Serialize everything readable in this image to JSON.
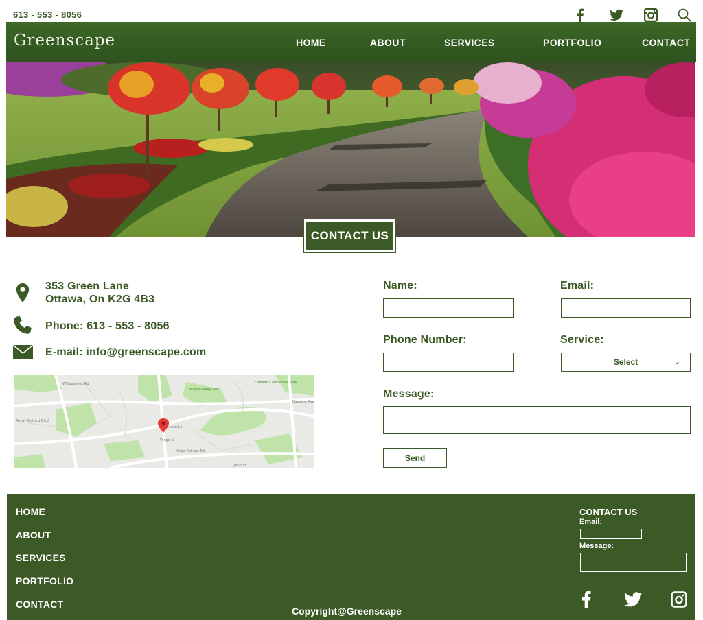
{
  "topbar": {
    "phone": "613 - 553 - 8056",
    "icons": [
      "facebook-icon",
      "twitter-icon",
      "instagram-icon",
      "search-icon"
    ]
  },
  "header": {
    "brand": "Greenscape",
    "nav": [
      "HOME",
      "ABOUT",
      "SERVICES",
      "PORTFOLIO",
      "CONTACT"
    ]
  },
  "hero": {
    "badge": "CONTACT US"
  },
  "contact_info": {
    "address_line1": "353 Green Lane",
    "address_line2": "Ottawa, On K2G 4B3",
    "phone": "Phone: 613 - 553 - 8056",
    "email": "E-mail: info@greenscape.com"
  },
  "map": {
    "labels": [
      "Willowbrook Rd",
      "Maple Valley Park",
      "Franklin Carmichael Park",
      "Green Ln",
      "Royal Orchard Blvd",
      "Kings College Rd",
      "John St",
      "Bayview Ave",
      "Yonge St"
    ]
  },
  "form": {
    "name_label": "Name:",
    "email_label": "Email:",
    "phone_label": "Phone Number:",
    "service_label": "Service:",
    "service_selected": "Select",
    "message_label": "Message:",
    "send_label": "Send"
  },
  "footer": {
    "links": [
      "HOME",
      "ABOUT",
      "SERVICES",
      "PORTFOLIO",
      "CONTACT"
    ],
    "copyright": "Copyright@Greenscape",
    "contact_title": "CONTACT US",
    "email_label": "Email:",
    "message_label": "Message:"
  },
  "colors": {
    "brand_green": "#3b5a26",
    "white": "#ffffff"
  }
}
